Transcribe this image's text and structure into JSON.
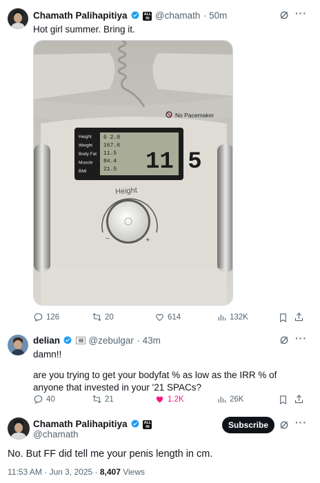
{
  "tweet1": {
    "name": "Chamath Palihapitiya",
    "handle": "@chamath",
    "time": "· 50m",
    "text": "Hot girl summer. Bring it.",
    "image": {
      "warning": "No Pacemaker",
      "lcd_labels": [
        "Height",
        "Weight",
        "Body Fat",
        "Muscle",
        "BMI"
      ],
      "lcd_values": [
        "6 2.0",
        "167.6",
        "11.5",
        "84.4",
        "21.5"
      ],
      "lcd_big": "11.5",
      "dial_label": "Height",
      "dial_minus": "−",
      "dial_plus": "+"
    },
    "replies": "126",
    "reposts": "20",
    "likes": "614",
    "views": "132K"
  },
  "tweet2": {
    "name": "delian",
    "handle": "@zebulgar",
    "time": "· 43m",
    "text_line1": "damn!!",
    "text_line2": "are you trying to get your bodyfat % as low as the IRR % of anyone that invested in your '21 SPACs?",
    "replies": "40",
    "reposts": "21",
    "likes": "1.2K",
    "views": "26K"
  },
  "tweet3": {
    "name": "Chamath Palihapitiya",
    "handle": "@chamath",
    "subscribe": "Subscribe",
    "text": "No. But FF did tell me your penis length in cm.",
    "timestamp": "11:53 AM · Jun 3, 2025 · ",
    "views_count": "8,407",
    "views_label": " Views"
  },
  "colors": {
    "verified": "#1d9bf0",
    "secondary": "#536471",
    "like": "#f91880"
  }
}
